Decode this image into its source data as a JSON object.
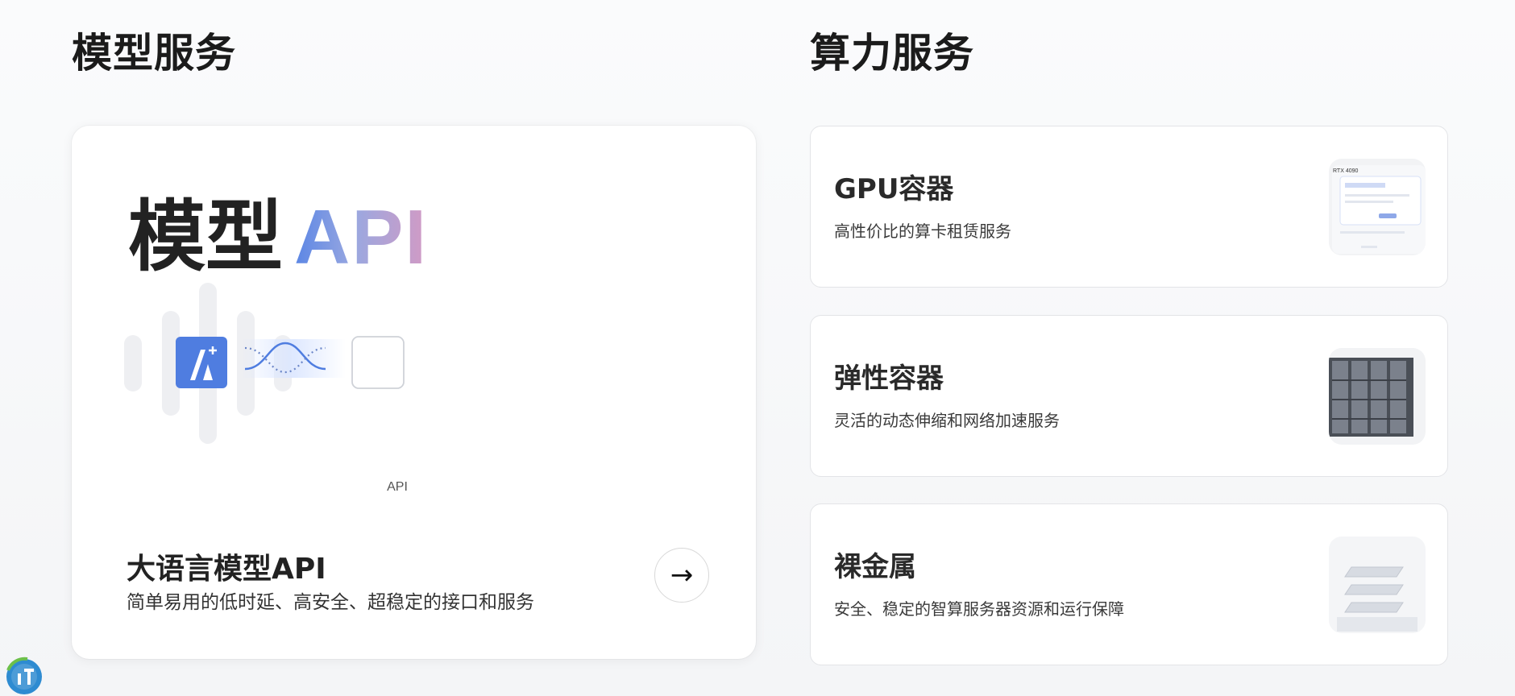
{
  "sections": {
    "model": {
      "title": "模型服务"
    },
    "compute": {
      "title": "算力服务"
    }
  },
  "model_card": {
    "hero_zh": "模型",
    "hero_api": "API",
    "badge_label": "API",
    "heading": "大语言模型API",
    "subtitle": "简单易用的低时延、高安全、超稳定的接口和服务",
    "arrow": "→",
    "gradient_colors": [
      "#5b86e5",
      "#9aa8e0",
      "#d39ac4"
    ],
    "logo_color": "#4f7de0"
  },
  "services": [
    {
      "title": "GPU容器",
      "desc": "高性价比的算卡租赁服务",
      "thumb_icon": "gpu-selector-screenshot",
      "thumb_text": "RTX 4090"
    },
    {
      "title": "弹性容器",
      "desc": "灵活的动态伸缩和网络加速服务",
      "thumb_icon": "server-rack-image"
    },
    {
      "title": "裸金属",
      "desc": "安全、稳定的智算服务器资源和运行保障",
      "thumb_icon": "stacked-layers-image"
    }
  ]
}
